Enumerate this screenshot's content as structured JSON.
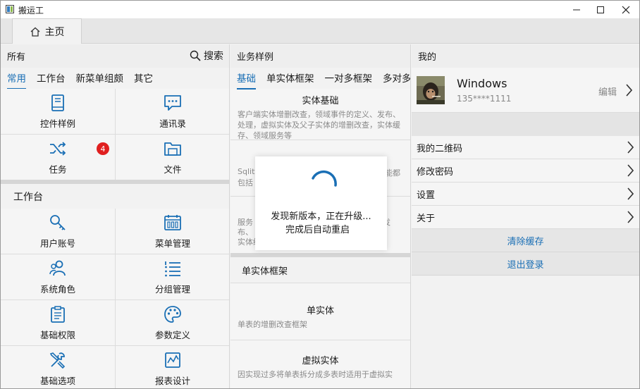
{
  "window": {
    "title": "搬运工"
  },
  "tabs": [
    {
      "label": "主页"
    }
  ],
  "left": {
    "header": "所有",
    "search_label": "搜索",
    "subtabs": [
      "常用",
      "工作台",
      "新菜单组颇",
      "其它"
    ],
    "common_items": [
      {
        "label": "控件样例",
        "icon": "book-icon"
      },
      {
        "label": "通讯录",
        "icon": "chat-icon"
      },
      {
        "label": "任务",
        "icon": "shuffle-icon",
        "badge": "4"
      },
      {
        "label": "文件",
        "icon": "folder-icon"
      }
    ],
    "workbench_title": "工作台",
    "workbench_items": [
      {
        "label": "用户账号",
        "icon": "key-icon"
      },
      {
        "label": "菜单管理",
        "icon": "calendar-icon"
      },
      {
        "label": "系统角色",
        "icon": "people-icon"
      },
      {
        "label": "分组管理",
        "icon": "list-icon"
      },
      {
        "label": "基础权限",
        "icon": "clipboard-icon"
      },
      {
        "label": "参数定义",
        "icon": "palette-icon"
      },
      {
        "label": "基础选项",
        "icon": "tools-icon"
      },
      {
        "label": "报表设计",
        "icon": "chart-icon"
      }
    ]
  },
  "middle": {
    "header": "业务样例",
    "subtabs": [
      "基础",
      "单实体框架",
      "一对多框架",
      "多对多"
    ],
    "cards": [
      {
        "title": "实体基础",
        "desc": "客户端实体增删改查，领域事件的定义、发布、处理，虚拟实体及父子实体的增删改查，实体缓存、领域服务等"
      }
    ],
    "frag2_left": "Sqlit",
    "frag2_left2": "包括",
    "frag2_right": "能都",
    "frag3_lines": [
      "服务",
      "布、",
      "实体缓存等"
    ],
    "frag3_right": "发",
    "section2_title": "单实体框架",
    "cards2": [
      {
        "title": "单实体",
        "desc": "单表的增删改查框架"
      },
      {
        "title": "虚拟实体",
        "desc": "因实现过多将单表拆分成多表时适用于虚拟实"
      }
    ]
  },
  "right": {
    "header": "我的",
    "profile_name": "Windows",
    "profile_phone": "135****1111",
    "edit_label": "编辑",
    "menu": [
      "我的二维码",
      "修改密码",
      "设置",
      "关于"
    ],
    "clear_cache": "清除缓存",
    "logout": "退出登录"
  },
  "dialog": {
    "line1": "发现新版本，正在升级...",
    "line2": "完成后自动重启"
  },
  "colors": {
    "accent": "#1a6fb5",
    "badge": "#e01f1f",
    "icon": "#1a6fb5"
  }
}
